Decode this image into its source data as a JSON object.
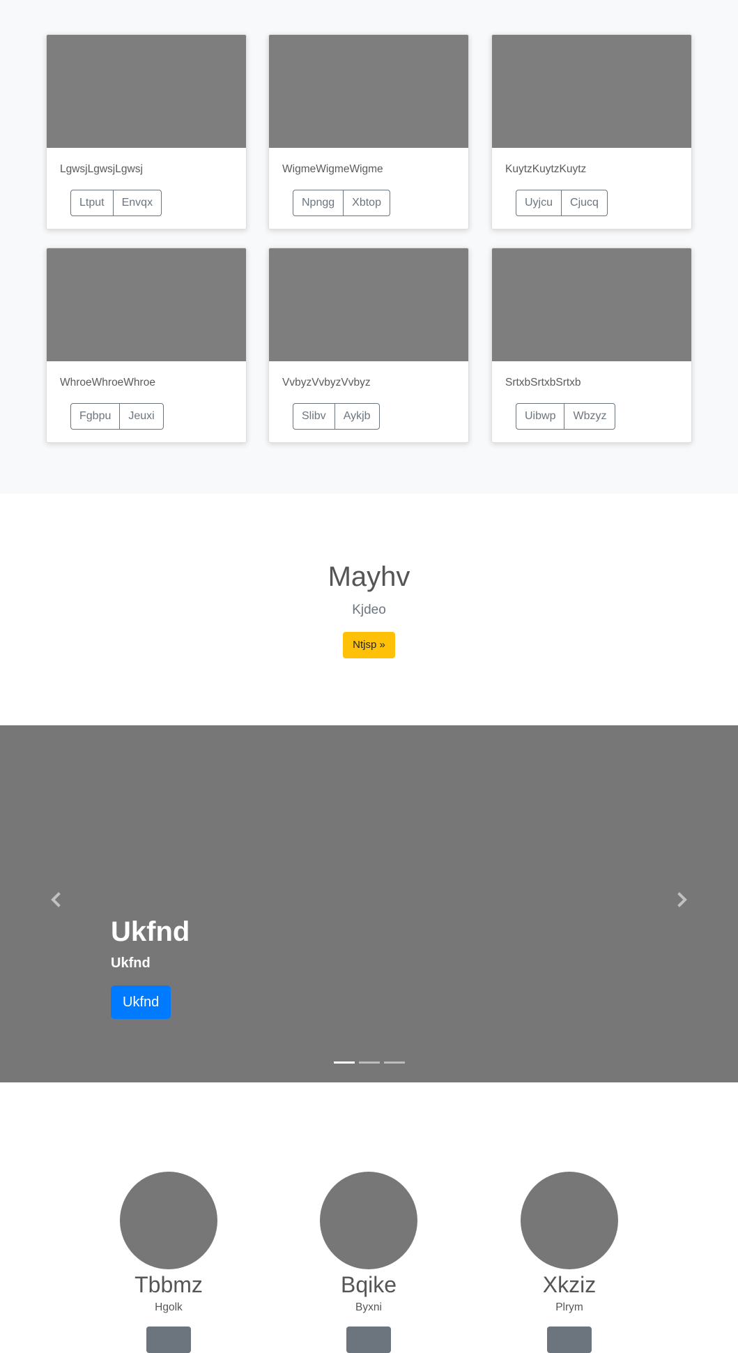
{
  "album": {
    "cards": [
      {
        "text": "LgwsjLgwsjLgwsj",
        "buttons": [
          "Ltput",
          "Envqx"
        ]
      },
      {
        "text": "WigmeWigmeWigme",
        "buttons": [
          "Npngg",
          "Xbtop"
        ]
      },
      {
        "text": "KuytzKuytzKuytz",
        "buttons": [
          "Uyjcu",
          "Cjucq"
        ]
      },
      {
        "text": "WhroeWhroeWhroe",
        "buttons": [
          "Fgbpu",
          "Jeuxi"
        ]
      },
      {
        "text": "VvbyzVvbyzVvbyz",
        "buttons": [
          "Slibv",
          "Aykjb"
        ]
      },
      {
        "text": "SrtxbSrtxbSrtxb",
        "buttons": [
          "Uibwp",
          "Wbzyz"
        ]
      }
    ]
  },
  "jumbotron": {
    "title": "Mayhv",
    "lead": "Kjdeo",
    "button": "Ntjsp »"
  },
  "carousel": {
    "caption_title": "Ukfnd",
    "caption_sub": "Ukfnd",
    "button": "Ukfnd",
    "prev_icon": "chevron-left-icon",
    "next_icon": "chevron-right-icon",
    "slide_count": 3,
    "active_slide": 1
  },
  "marketing": {
    "features": [
      {
        "title": "Tbbmz",
        "text": "Hgolk",
        "button": ""
      },
      {
        "title": "Bqike",
        "text": "Byxni",
        "button": ""
      },
      {
        "title": "Xkziz",
        "text": "Plrym",
        "button": ""
      }
    ]
  },
  "colors": {
    "placeholder_gray": "#7e7e7e",
    "warning": "#ffc107",
    "primary": "#007bff",
    "secondary": "#6c757d",
    "album_bg": "#f8f9fa"
  }
}
